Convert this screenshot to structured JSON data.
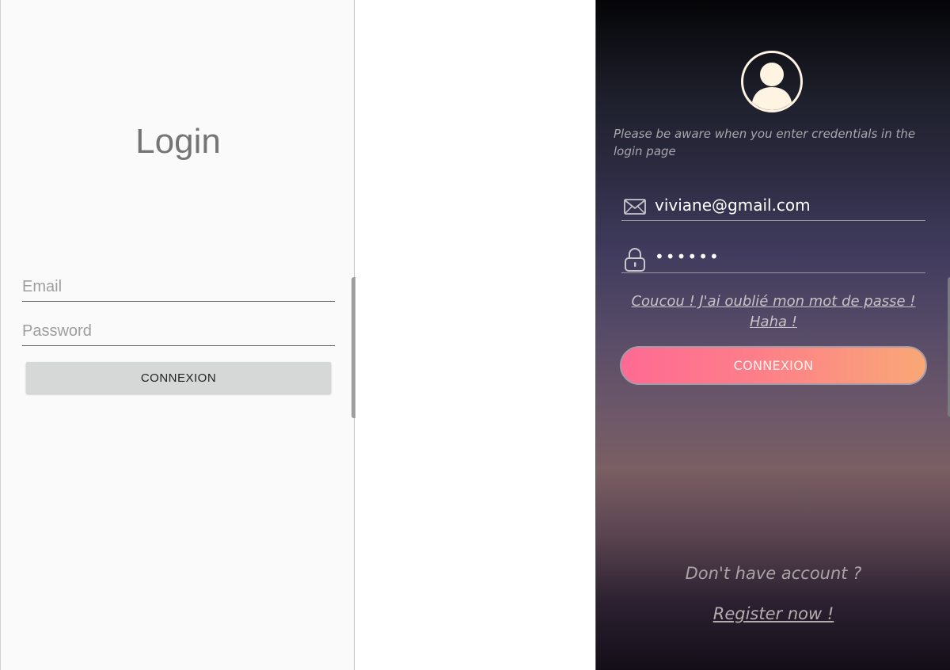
{
  "left_screen": {
    "title": "Login",
    "email_placeholder": "Email",
    "password_placeholder": "Password",
    "button_label": "CONNEXION"
  },
  "right_screen": {
    "notice": "Please be aware when you enter credentials in the login page",
    "email_value": "viviane@gmail.com",
    "password_value": "••••••",
    "forgot_line1": "Coucou ! J'ai oublié mon mot de passe !",
    "forgot_line2": "Haha !",
    "button_label": "CONNEXION",
    "no_account_text": "Don't have account ?",
    "register_link": "Register now !",
    "colors": {
      "avatar": "#fff3e2",
      "button_gradient_start": "#fe6a93",
      "button_gradient_end": "#f9a876"
    },
    "icons": {
      "avatar": "user-avatar-icon",
      "email": "envelope-icon",
      "password": "padlock-icon"
    }
  }
}
